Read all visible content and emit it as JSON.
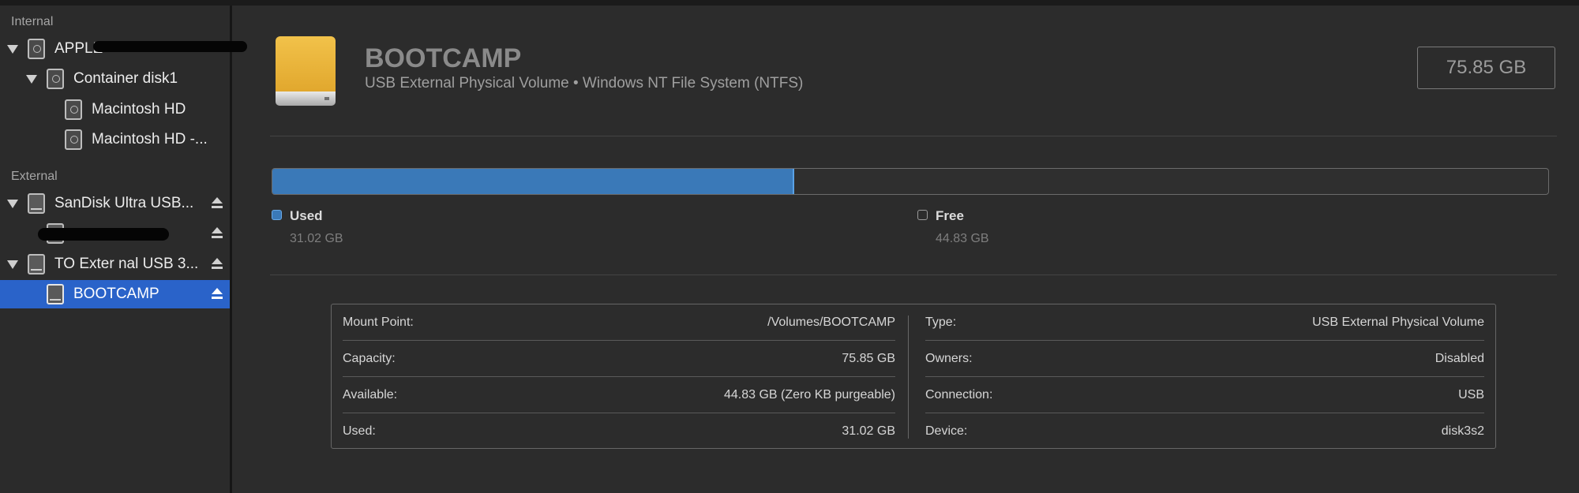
{
  "sidebar": {
    "internal_title": "Internal",
    "external_title": "External",
    "items": [
      {
        "label": "APPLE"
      },
      {
        "label": "Container disk1"
      },
      {
        "label": "Macintosh HD"
      },
      {
        "label": "Macintosh HD -..."
      },
      {
        "label": "SanDisk Ultra USB..."
      },
      {
        "label": ""
      },
      {
        "label": "TO Exter nal USB 3..."
      },
      {
        "label": "BOOTCAMP"
      }
    ]
  },
  "volume": {
    "name": "BOOTCAMP",
    "subtitle": "USB External Physical Volume • Windows NT File System (NTFS)",
    "capacity": "75.85 GB"
  },
  "usage": {
    "used_fraction": 0.409,
    "used_label": "Used",
    "used_value": "31.02 GB",
    "free_label": "Free",
    "free_value": "44.83 GB",
    "used_color": "#3a79b8"
  },
  "info": {
    "left": [
      {
        "key": "Mount Point:",
        "value": "/Volumes/BOOTCAMP"
      },
      {
        "key": "Capacity:",
        "value": "75.85 GB"
      },
      {
        "key": "Available:",
        "value": "44.83 GB (Zero KB purgeable)"
      },
      {
        "key": "Used:",
        "value": "31.02 GB"
      }
    ],
    "right": [
      {
        "key": "Type:",
        "value": "USB External Physical Volume"
      },
      {
        "key": "Owners:",
        "value": "Disabled"
      },
      {
        "key": "Connection:",
        "value": "USB"
      },
      {
        "key": "Device:",
        "value": "disk3s2"
      }
    ]
  },
  "colors": {
    "selection": "#2a63c9",
    "background": "#2c2c2c"
  }
}
